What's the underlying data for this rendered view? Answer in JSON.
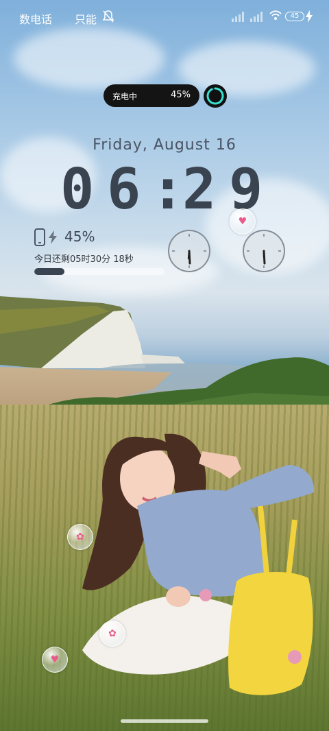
{
  "status_bar": {
    "carrier1": "数电话",
    "carrier2": "只能",
    "battery_level": "45"
  },
  "charging": {
    "label": "充电中",
    "percent": "45%",
    "progress": 0.45
  },
  "lockscreen": {
    "date": "Friday,  August  16",
    "time_h1": "0",
    "time_h2": "6",
    "time_colon": ":",
    "time_m1": "2",
    "time_m2": "9"
  },
  "battery_widget": {
    "percent": "45%",
    "remaining": "今日还剩05时30分 18秒",
    "progress": 0.23
  },
  "icons": [
    "bell-muted-icon",
    "signal-icon",
    "wifi-icon",
    "battery-icon",
    "bolt-icon",
    "phone-icon",
    "clock-icon",
    "heart-bubble-icon",
    "flower-bubble-icon"
  ],
  "colors": {
    "time_text": "#3a4350",
    "charge_ring": "#37e0d0",
    "bubble_heart": "#e85c8a"
  }
}
